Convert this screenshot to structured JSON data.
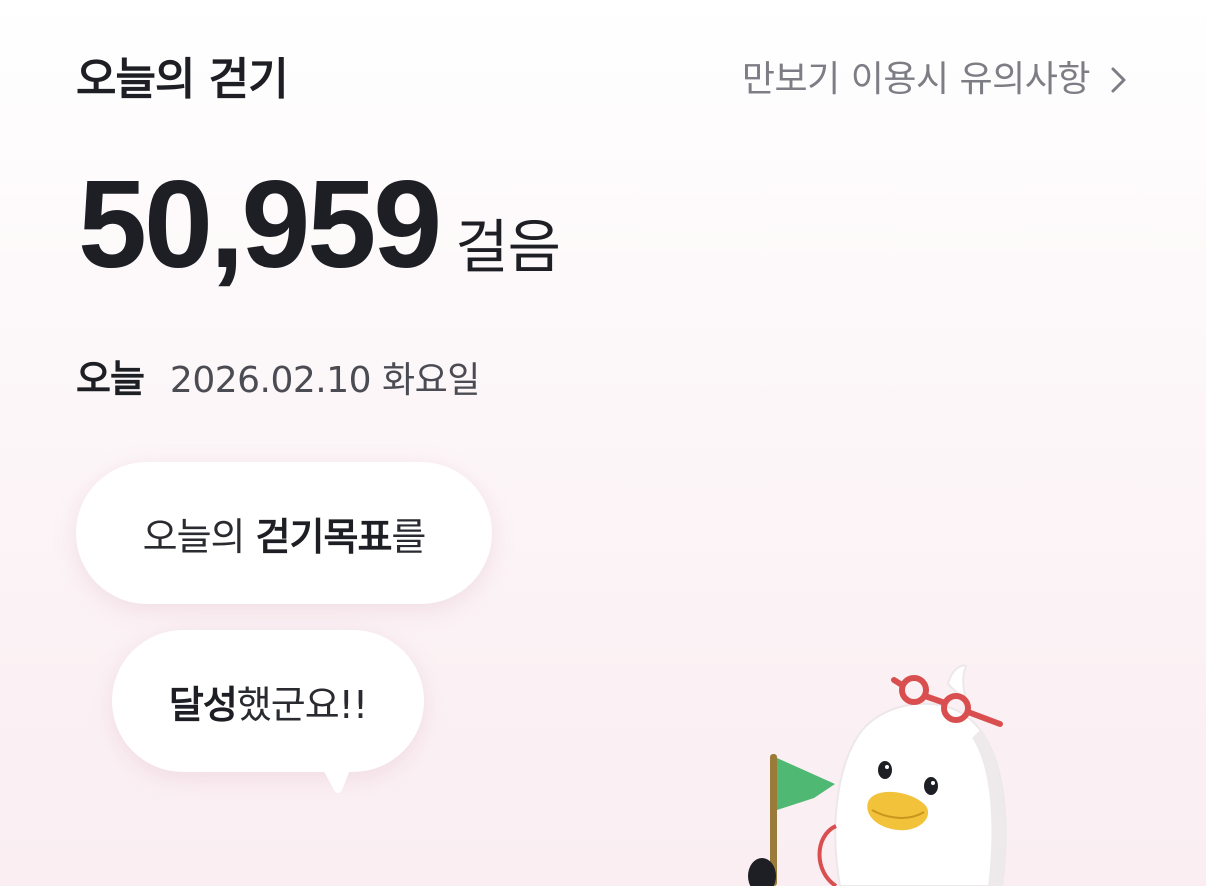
{
  "header": {
    "title": "오늘의 걷기",
    "notice_link": "만보기 이용시 유의사항",
    "notice_icon": "chevron-right-icon"
  },
  "steps": {
    "count": "50,959",
    "unit": "걸음"
  },
  "date": {
    "label": "오늘",
    "value": "2026.02.10 화요일"
  },
  "bubbles": {
    "line1_pre": "오늘의 ",
    "line1_bold": "걷기목표",
    "line1_post": "를",
    "line2_bold": "달성",
    "line2_post": "했군요!!"
  },
  "colors": {
    "text_primary": "#1e1f24",
    "text_secondary": "#7d7e85",
    "background_tint": "#faeef2",
    "flag_green": "#4fb873",
    "glasses_red": "#d94f4f",
    "beak_yellow": "#f2c23a"
  },
  "mascot": {
    "icon": "duck-mascot-with-flag-icon"
  }
}
